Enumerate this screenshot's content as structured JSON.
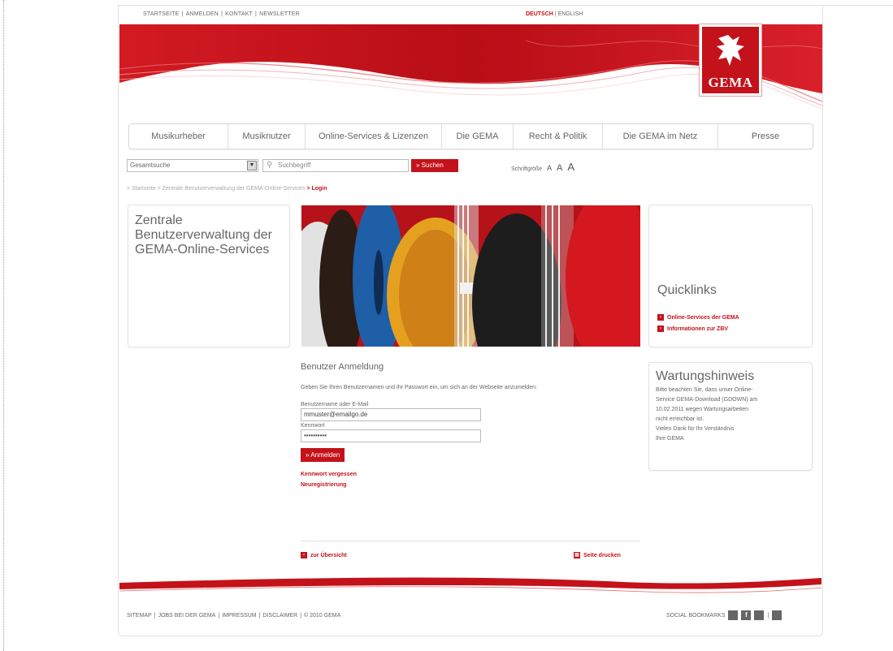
{
  "top_nav": {
    "items": [
      "STARTSEITE",
      "ANMELDEN",
      "KONTAKT",
      "NEWSLETTER"
    ],
    "separator": "|"
  },
  "lang_nav": {
    "active": "DEUTSCH",
    "other": "ENGLISH",
    "separator": "|"
  },
  "logo": {
    "text": "GEMA"
  },
  "main_nav": {
    "items": [
      "Musikurheber",
      "Musiknutzer",
      "Online-Services & Lizenzen",
      "Die GEMA",
      "Recht & Politik",
      "Die GEMA im Netz",
      "Presse"
    ]
  },
  "search": {
    "scope_value": "Gesamtsuche",
    "placeholder": "Suchbegriff",
    "button_label": "» Suchen"
  },
  "font_size": {
    "label": "Schriftgröße",
    "options": [
      "A",
      "A",
      "A"
    ]
  },
  "breadcrumb": {
    "items": [
      "> Startseite",
      "> Zentrale Benutzerverwaltung der GEMA-Online-Services"
    ],
    "current": "> Login"
  },
  "left_box": {
    "title": "Zentrale Benutzerverwaltung der GEMA-Online-Services"
  },
  "quicklinks": {
    "title": "Quicklinks",
    "links": [
      "Online-Services der GEMA",
      "Informationen zur ZBV"
    ]
  },
  "maintenance": {
    "title": "Wartungshinweis",
    "lines": [
      "Bitte beachten Sie, dass unser Online-",
      "Service GEMA-Download (GDOWN) am",
      "10.02.2011 wegen Wartungsarbeiten",
      "nicht erreichbar ist.",
      "Vielen Dank für Ihr Verständnis",
      "Ihre GEMA"
    ]
  },
  "login": {
    "title": "Benutzer Anmeldung",
    "intro": "Geben Sie Ihren Benutzernamen und Ihr Passwort ein, um sich an der Webseite anzumelden:",
    "username_label": "Benutzername oder E-Mail",
    "username_value": "mmuster@emailgo.de",
    "password_label": "Kennwort",
    "password_value": "••••••••••",
    "submit_label": "» Anmelden",
    "forgot_link": "Kennwort vergessen",
    "register_link": "Neuregistrierung"
  },
  "page_actions": {
    "back_label": "zur Übersicht",
    "print_label": "Seite drucken"
  },
  "footer": {
    "items": [
      "SITEMAP",
      "JOBS BEI DER GEMA",
      "IMPRESSUM",
      "DISCLAIMER",
      "© 2010 GEMA"
    ],
    "separator": "|",
    "social_label": "SOCIAL BOOKMARKS"
  },
  "colors": {
    "brand_red": "#c4121a"
  }
}
